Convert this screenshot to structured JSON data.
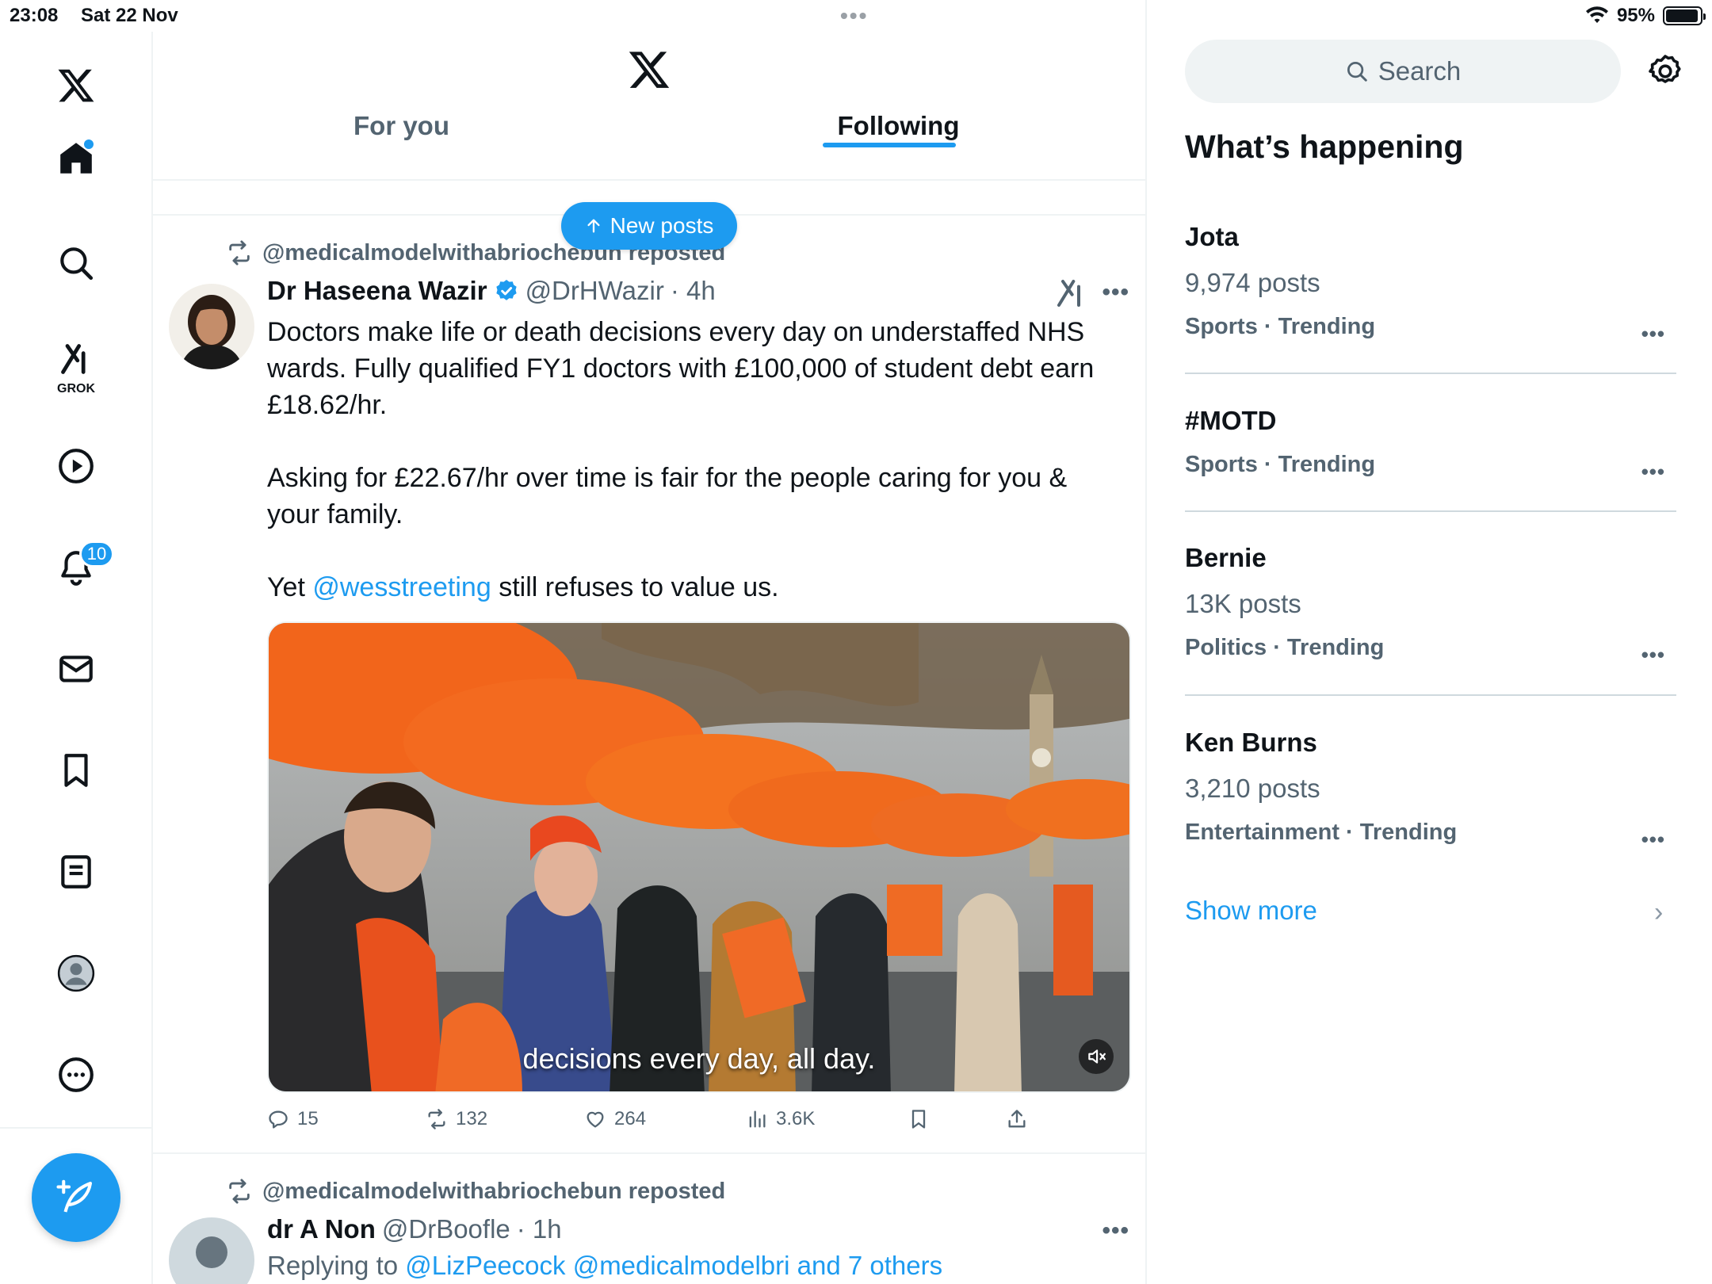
{
  "status_bar": {
    "time": "23:08",
    "date": "Sat 22 Nov",
    "battery": "95%",
    "battery_level": 0.95
  },
  "left_nav": {
    "items": [
      {
        "icon": "x-logo-icon"
      },
      {
        "icon": "home-icon",
        "has_dot": true
      },
      {
        "icon": "search-icon"
      },
      {
        "icon": "grok-icon",
        "label": "GROK"
      },
      {
        "icon": "video-play-icon"
      },
      {
        "icon": "bell-icon",
        "badge": "10"
      },
      {
        "icon": "mail-icon"
      },
      {
        "icon": "bookmark-icon"
      },
      {
        "icon": "list-icon"
      },
      {
        "icon": "profile-avatar-icon"
      },
      {
        "icon": "more-circle-icon"
      }
    ],
    "compose_icon": "feather-plus-icon"
  },
  "header": {
    "tabs": [
      {
        "label": "For you",
        "active": false
      },
      {
        "label": "Following",
        "active": true
      }
    ]
  },
  "new_posts": {
    "label": "New posts"
  },
  "posts": [
    {
      "repost_by": "@medicalmodelwithabriochebun reposted",
      "author_name": "Dr Haseena Wazir",
      "verified": true,
      "handle": "@DrHWazir",
      "time": "· 4h",
      "text_1": "Doctors make life or death decisions every day on understaffed NHS wards. Fully qualified FY1 doctors with £100,000 of student debt earn £18.62/hr.",
      "text_2": "Asking for £22.67/hr over time is fair for the people caring for you & your family.",
      "text_3_pre": "Yet ",
      "text_3_mention": "@wesstreeting",
      "text_3_post": " still refuses to value us.",
      "video_caption": "decisions every day, all day.",
      "replies": "15",
      "reposts": "132",
      "likes": "264",
      "views": "3.6K"
    },
    {
      "repost_by": "@medicalmodelwithabriochebun reposted",
      "author_name": "dr A Non",
      "handle": "@DrBoofle",
      "time": "· 1h",
      "replying_prefix": "Replying to ",
      "replying_to": "@LizPeecock @medicalmodelbri and 7 others"
    }
  ],
  "sidebar": {
    "search_placeholder": "Search",
    "title": "What’s happening",
    "trends": [
      {
        "title": "Jota",
        "posts": "9,974 posts",
        "meta": "Sports · Trending"
      },
      {
        "title": "#MOTD",
        "meta": "Sports · Trending"
      },
      {
        "title": "Bernie",
        "posts": "13K posts",
        "meta": "Politics · Trending"
      },
      {
        "title": "Ken Burns",
        "posts": "3,210 posts",
        "meta": "Entertainment · Trending"
      }
    ],
    "show_more": "Show more"
  },
  "colors": {
    "accent": "#1d9bf0",
    "text_primary": "#0f1419",
    "text_secondary": "#536471",
    "divider": "#eff3f4"
  }
}
